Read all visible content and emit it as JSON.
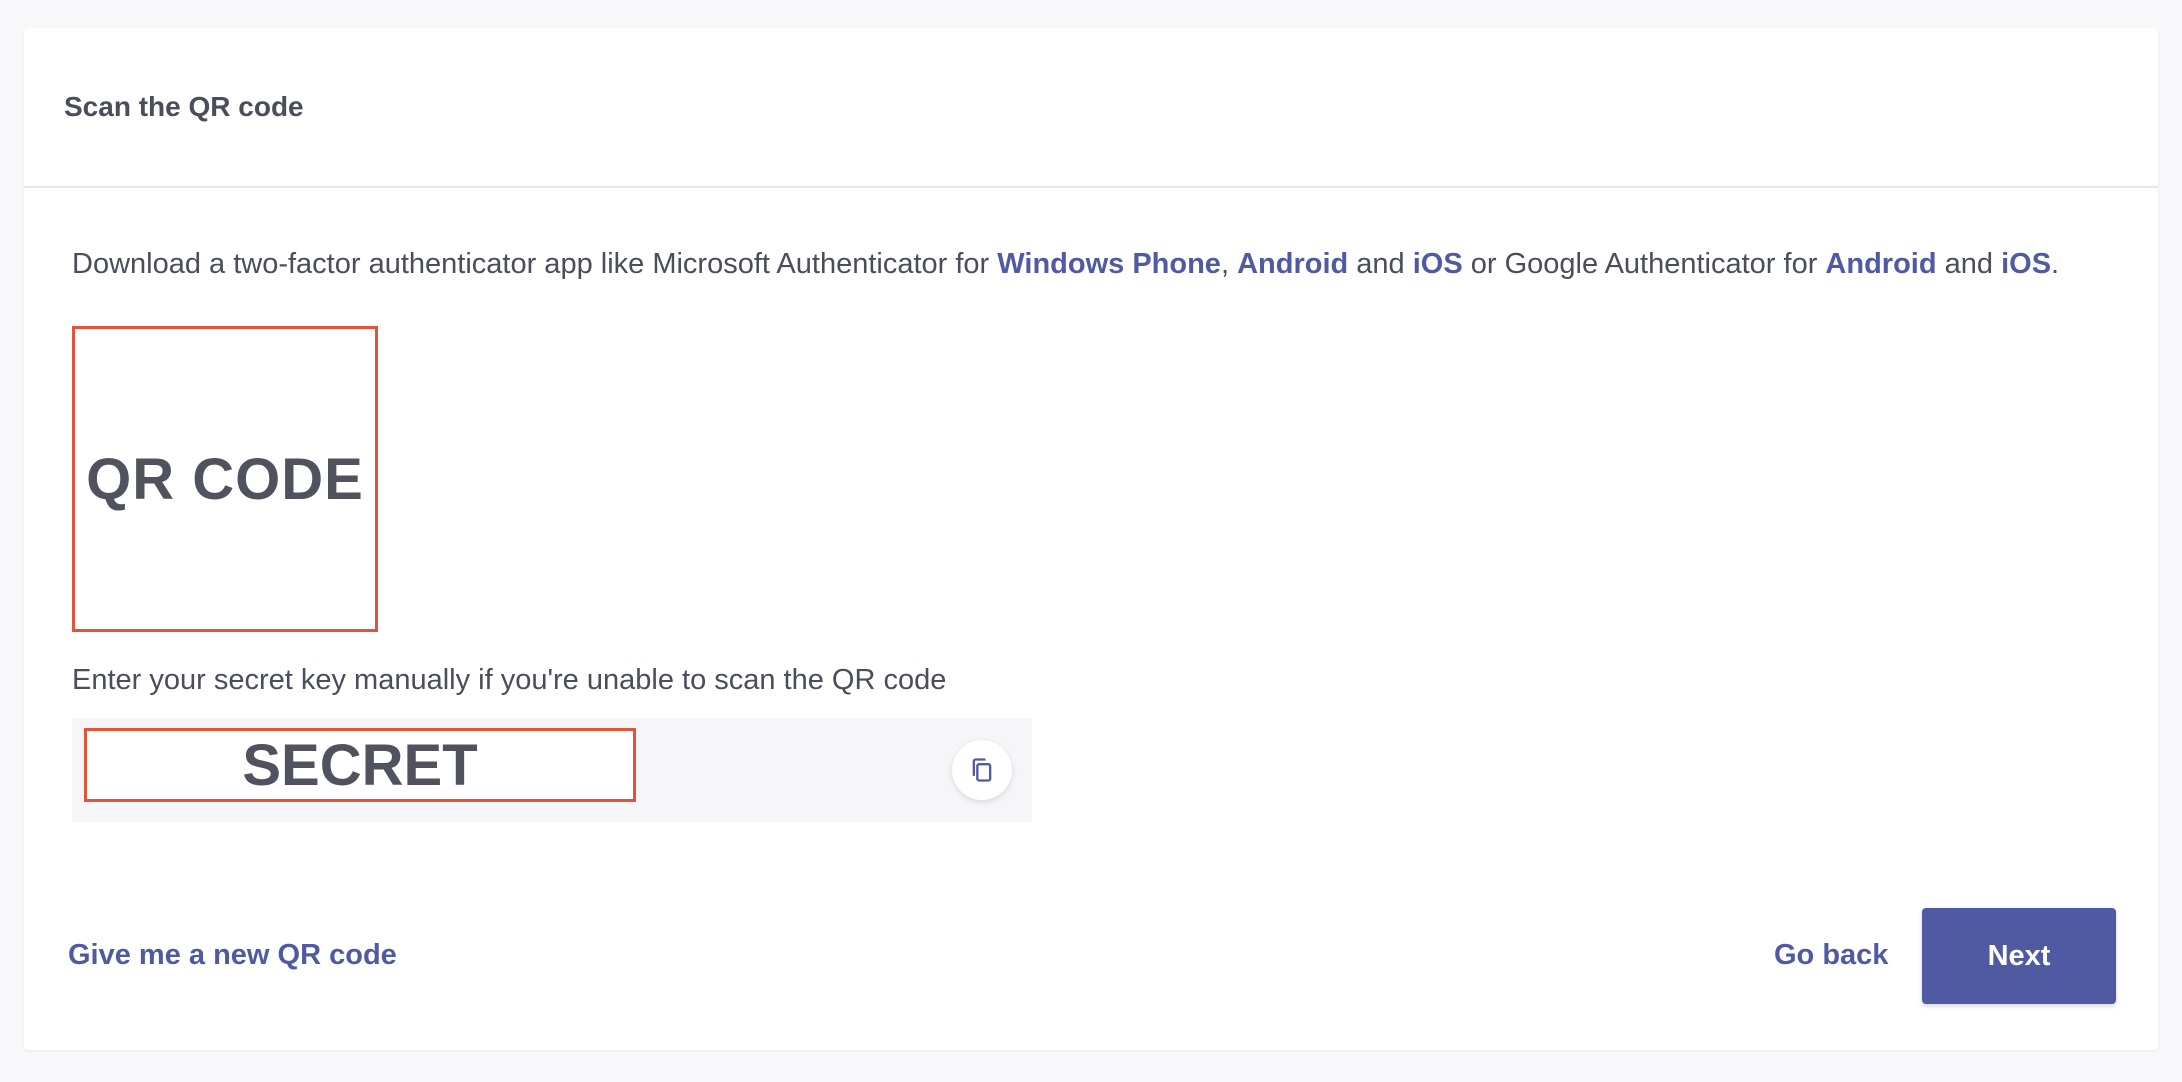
{
  "card": {
    "title": "Scan the QR code"
  },
  "intro": {
    "part1": "Download a two-factor authenticator app like Microsoft Authenticator for ",
    "link_windows_phone": "Windows Phone",
    "sep1": ", ",
    "link_android_ms": "Android",
    "and1": " and ",
    "link_ios_ms": "iOS",
    "part2": " or Google Authenticator for ",
    "link_android_google": "Android",
    "and2": " and ",
    "link_ios_google": "iOS",
    "end": "."
  },
  "qr": {
    "placeholder_text": "QR CODE"
  },
  "manual": {
    "hint": "Enter your secret key manually if you're unable to scan the QR code",
    "secret_text": "SECRET",
    "copy_icon": "copy-icon"
  },
  "footer": {
    "new_qr_label": "Give me a new QR code",
    "go_back_label": "Go back",
    "next_label": "Next"
  },
  "colors": {
    "accent": "#4f5aa3",
    "highlight_border": "#e2533a",
    "text": "#4a4d5a",
    "background": "#f8f8fa"
  }
}
